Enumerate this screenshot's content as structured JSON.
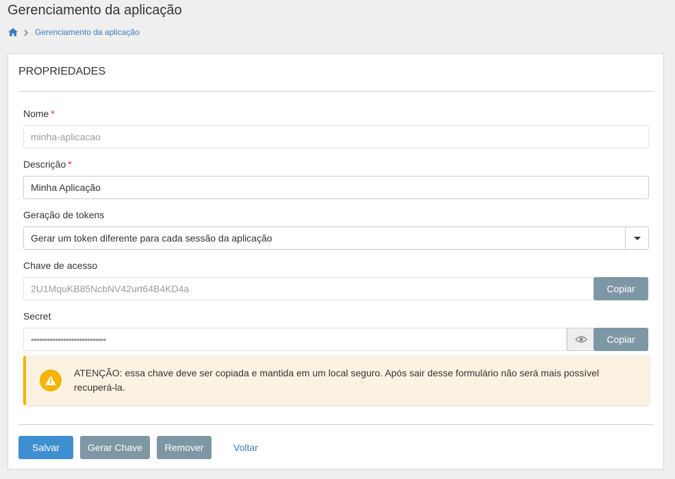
{
  "page": {
    "title": "Gerenciamento da aplicação"
  },
  "breadcrumb": {
    "home_icon": "home-icon",
    "items": [
      {
        "label": "Gerenciamento da aplicação"
      }
    ]
  },
  "panel": {
    "header": "PROPRIEDADES"
  },
  "form": {
    "nome": {
      "label": "Nome",
      "required": "*",
      "value": "minha-aplicacao"
    },
    "descricao": {
      "label": "Descrição",
      "required": "*",
      "value": "Minha Aplicação"
    },
    "geracao_tokens": {
      "label": "Geração de tokens",
      "selected": "Gerar um token diferente para cada sessão da aplicação"
    },
    "chave_acesso": {
      "label": "Chave de acesso",
      "value": "2U1MquKB85NcbNV42urt64B4KD4a",
      "copy_label": "Copiar"
    },
    "secret": {
      "label": "Secret",
      "value": "••••••••••••••••••••••••••••",
      "eye_icon": "eye-icon",
      "copy_label": "Copiar"
    }
  },
  "alert": {
    "icon": "warning-icon",
    "color": "#f4b400",
    "text": "ATENÇÃO: essa chave deve ser copiada e mantida em um local seguro. Após sair desse formulário não será mais possível recuperá-la."
  },
  "actions": {
    "save_label": "Salvar",
    "generate_key_label": "Gerar Chave",
    "remove_label": "Remover",
    "back_label": "Voltar"
  },
  "colors": {
    "primary": "#3d8fd0",
    "secondary": "#7e97a5",
    "link": "#3a7cc4",
    "required": "#d9302c"
  }
}
